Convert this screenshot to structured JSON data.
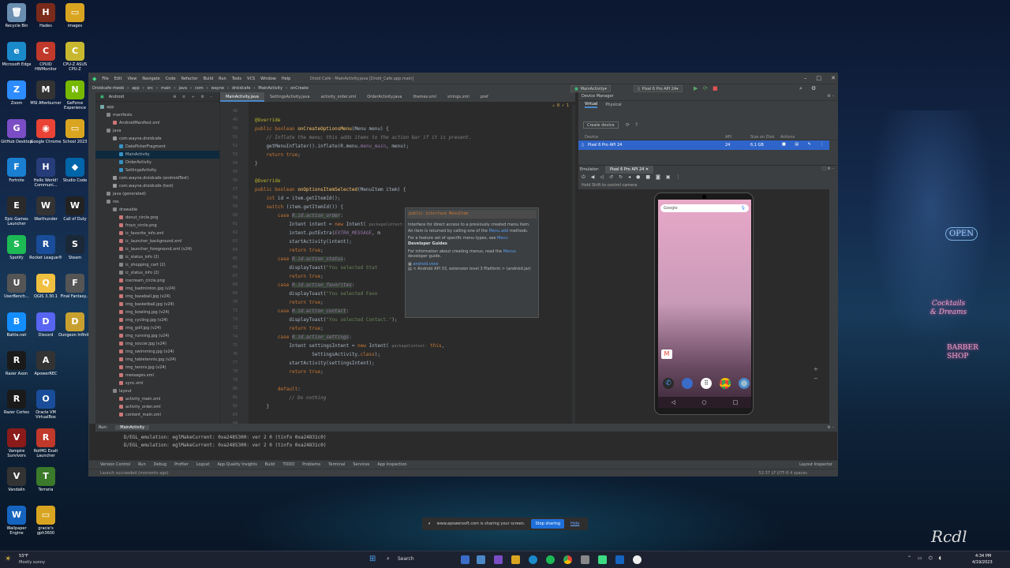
{
  "desktop": {
    "icons": [
      {
        "label": "Recycle Bin",
        "color": "#6b8fb0",
        "glyph": "🗑"
      },
      {
        "label": "Microsoft Edge",
        "color": "#1b8acb",
        "glyph": "e"
      },
      {
        "label": "Zoom",
        "color": "#2d8cff",
        "glyph": "Z"
      },
      {
        "label": "GitHub Desktop",
        "color": "#7a4dc4",
        "glyph": "G"
      },
      {
        "label": "Fortnite",
        "color": "#1a7fd0",
        "glyph": "F"
      },
      {
        "label": "Epic Games Launcher",
        "color": "#2a2a2a",
        "glyph": "E"
      },
      {
        "label": "Spotify",
        "color": "#1db954",
        "glyph": "S"
      },
      {
        "label": "UserBench...",
        "color": "#555",
        "glyph": "U"
      },
      {
        "label": "Battle.net",
        "color": "#148eff",
        "glyph": "B"
      },
      {
        "label": "Razer Axon",
        "color": "#1a1a1a",
        "glyph": "R"
      },
      {
        "label": "Razer Cortex",
        "color": "#1a1a1a",
        "glyph": "R"
      },
      {
        "label": "Vampire Survivors",
        "color": "#8b1a1a",
        "glyph": "V"
      },
      {
        "label": "Vandalin",
        "color": "#333",
        "glyph": "V"
      },
      {
        "label": "Wallpaper Engine",
        "color": "#1565c0",
        "glyph": "W"
      },
      {
        "label": "Hades",
        "color": "#7a2a1a",
        "glyph": "H"
      },
      {
        "label": "CPUID HWMonitor",
        "color": "#c0392b",
        "glyph": "C"
      },
      {
        "label": "MSI Afterburner",
        "color": "#333",
        "glyph": "M"
      },
      {
        "label": "Google Chrome",
        "color": "#ea4335",
        "glyph": "◉"
      },
      {
        "label": "Hello World! Communi...",
        "color": "#263d7a",
        "glyph": "H"
      },
      {
        "label": "Warthunder",
        "color": "#333",
        "glyph": "W"
      },
      {
        "label": "Rocket League®",
        "color": "#1a4d99",
        "glyph": "R"
      },
      {
        "label": "QGIS 3.30.1",
        "color": "#f0c040",
        "glyph": "Q"
      },
      {
        "label": "Discord",
        "color": "#5865f2",
        "glyph": "D"
      },
      {
        "label": "ApowerREC",
        "color": "#333",
        "glyph": "A"
      },
      {
        "label": "Oracle VM VirtualBox",
        "color": "#1a4d99",
        "glyph": "O"
      },
      {
        "label": "RotMG Exalt Launcher",
        "color": "#c0392b",
        "glyph": "R"
      },
      {
        "label": "Terraria",
        "color": "#3a7a2a",
        "glyph": "T"
      },
      {
        "label": "gracie's gph3600",
        "color": "#d9a521",
        "glyph": "▭"
      },
      {
        "label": "images",
        "color": "#d9a521",
        "glyph": "▭"
      },
      {
        "label": "CPU-Z ASUS CPU-Z",
        "color": "#c8b830",
        "glyph": "C"
      },
      {
        "label": "GeForce Experience",
        "color": "#76b900",
        "glyph": "N"
      },
      {
        "label": "School 2023",
        "color": "#d9a521",
        "glyph": "▭"
      },
      {
        "label": "Studio Code",
        "color": "#0065a9",
        "glyph": "◆"
      },
      {
        "label": "Call of Duty",
        "color": "#222",
        "glyph": "W"
      },
      {
        "label": "Steam",
        "color": "#1b2838",
        "glyph": "S"
      },
      {
        "label": "Final Fantasy...",
        "color": "#555",
        "glyph": "F"
      },
      {
        "label": "Dungeon Infinite",
        "color": "#c8a030",
        "glyph": "D"
      }
    ],
    "neon": {
      "open": "OPEN",
      "cocktails": "Cocktails & Dreams",
      "barber": "BARBER SHOP",
      "signature": "Rcdl"
    }
  },
  "ide": {
    "menu": [
      "File",
      "Edit",
      "View",
      "Navigate",
      "Code",
      "Refactor",
      "Build",
      "Run",
      "Tools",
      "VCS",
      "Window",
      "Help"
    ],
    "window_title": "Droid Cafe - MainActivity.java [Droid_Cafe.app.main]",
    "breadcrumbs": [
      "Droidcafe-rtweb",
      "app",
      "src",
      "main",
      "java",
      "com",
      "wayne",
      "droidcafe",
      "MainActivity",
      "onCreate"
    ],
    "run_config": "MainActivity",
    "device_config": "Pixel 6 Pro API 24",
    "project_view": "Android",
    "tree": [
      {
        "label": "app",
        "indent": 0,
        "color": "#7aa"
      },
      {
        "label": "manifests",
        "indent": 1,
        "color": "#888"
      },
      {
        "label": "AndroidManifest.xml",
        "indent": 2,
        "color": "#c77"
      },
      {
        "label": "java",
        "indent": 1,
        "color": "#888"
      },
      {
        "label": "com.wayne.droidcafe",
        "indent": 2,
        "color": "#999"
      },
      {
        "label": "DatePickerFragment",
        "indent": 3,
        "color": "#3592c4"
      },
      {
        "label": "MainActivity",
        "indent": 3,
        "color": "#3592c4",
        "selected": true
      },
      {
        "label": "OrderActivity",
        "indent": 3,
        "color": "#3592c4"
      },
      {
        "label": "SettingsActivity",
        "indent": 3,
        "color": "#3592c4"
      },
      {
        "label": "com.wayne.droidcafe (androidTest)",
        "indent": 2,
        "color": "#999"
      },
      {
        "label": "com.wayne.droidcafe (test)",
        "indent": 2,
        "color": "#999"
      },
      {
        "label": "java (generated)",
        "indent": 1,
        "color": "#888"
      },
      {
        "label": "res",
        "indent": 1,
        "color": "#888"
      },
      {
        "label": "drawable",
        "indent": 2,
        "color": "#888"
      },
      {
        "label": "donut_circle.png",
        "indent": 3,
        "color": "#c77"
      },
      {
        "label": "froyo_circle.png",
        "indent": 3,
        "color": "#c77"
      },
      {
        "label": "ic_favorite_info.xml",
        "indent": 3,
        "color": "#c77"
      },
      {
        "label": "ic_launcher_background.xml",
        "indent": 3,
        "color": "#c77"
      },
      {
        "label": "ic_launcher_foreground.xml (v24)",
        "indent": 3,
        "color": "#c77"
      },
      {
        "label": "ic_status_info (2)",
        "indent": 3,
        "color": "#888"
      },
      {
        "label": "ic_shopping_cart (2)",
        "indent": 3,
        "color": "#888"
      },
      {
        "label": "ic_status_info (2)",
        "indent": 3,
        "color": "#888"
      },
      {
        "label": "icecream_circle.png",
        "indent": 3,
        "color": "#c77"
      },
      {
        "label": "img_badminton.jpg (v24)",
        "indent": 3,
        "color": "#c77"
      },
      {
        "label": "img_baseball.jpg (v24)",
        "indent": 3,
        "color": "#c77"
      },
      {
        "label": "img_basketball.jpg (v24)",
        "indent": 3,
        "color": "#c77"
      },
      {
        "label": "img_bowling.jpg (v24)",
        "indent": 3,
        "color": "#c77"
      },
      {
        "label": "img_cycling.jpg (v24)",
        "indent": 3,
        "color": "#c77"
      },
      {
        "label": "img_golf.jpg (v24)",
        "indent": 3,
        "color": "#c77"
      },
      {
        "label": "img_running.jpg (v24)",
        "indent": 3,
        "color": "#c77"
      },
      {
        "label": "img_soccer.jpg (v24)",
        "indent": 3,
        "color": "#c77"
      },
      {
        "label": "img_swimming.jpg (v24)",
        "indent": 3,
        "color": "#c77"
      },
      {
        "label": "img_tabletennis.jpg (v24)",
        "indent": 3,
        "color": "#c77"
      },
      {
        "label": "img_tennis.jpg (v24)",
        "indent": 3,
        "color": "#c77"
      },
      {
        "label": "messages.xml",
        "indent": 3,
        "color": "#c77"
      },
      {
        "label": "sync.xml",
        "indent": 3,
        "color": "#c77"
      },
      {
        "label": "layout",
        "indent": 2,
        "color": "#888"
      },
      {
        "label": "activity_main.xml",
        "indent": 3,
        "color": "#c77"
      },
      {
        "label": "activity_order.xml",
        "indent": 3,
        "color": "#c77"
      },
      {
        "label": "content_main.xml",
        "indent": 3,
        "color": "#c77"
      }
    ],
    "tabs": [
      "MainActivity.java",
      "SettingsActivity.java",
      "activity_order.xml",
      "OrderActivity.java",
      "themes.xml",
      "strings.xml",
      "pref"
    ],
    "line_numbers": [
      "48",
      "49",
      "50",
      "51",
      "52",
      "53",
      "54",
      "55",
      "56",
      "57",
      "58",
      "59",
      "60",
      "61",
      "62",
      "63",
      "64",
      "65",
      "66",
      "67",
      "68",
      "69",
      "70",
      "71",
      "72",
      "73",
      "74",
      "75",
      "76",
      "77",
      "78",
      "79",
      "80",
      "81",
      "82",
      "83",
      "84",
      "85",
      "86",
      "87"
    ],
    "problems_count": "⚠ 8  ✓ 1",
    "popup": {
      "signature": "public interface MenuItem",
      "desc1": "Interface for direct access to a previously created menu item.",
      "desc2": "An item is returned by calling one of the",
      "desc2_link": "Menu.add",
      "desc2_end": "methods.",
      "desc3": "For a feature set of specific menu types, see",
      "desc3_link": "Menu",
      "guides_title": "Developer Guides",
      "guides_text": "For information about creating menus, read the",
      "guides_link": "Menus",
      "guides_end": "developer guide.",
      "pkg": "android.view",
      "platform": "< Android API 33, extension level 3 Platform > (android.jar)"
    },
    "device_manager": {
      "title": "Device Manager",
      "tabs": [
        "Virtual",
        "Physical"
      ],
      "create": "Create device",
      "columns": [
        "Device",
        "API",
        "Size on Disk",
        "Actions"
      ],
      "device": {
        "name": "Pixel 6 Pro API 24",
        "api": "24",
        "size": "6.1 GB"
      }
    },
    "emulator": {
      "label": "Emulator:",
      "tab": "Pixel 6 Pro API 24",
      "hint": "Hold Shift to control camera",
      "search": "Google"
    },
    "run": {
      "tab": "Run:",
      "config": "MainActivity",
      "lines": [
        "D/EGL_emulation: eglMakeCurrent: 0xa2485300: ver 2 0 (tinfo 0xa24831c0)",
        "D/EGL_emulation: eglMakeCurrent: 0xa2485300: ver 2 0 (tinfo 0xa24831c0)"
      ]
    },
    "toolwindows": [
      "Version Control",
      "Run",
      "Debug",
      "Profiler",
      "Logcat",
      "App Quality Insights",
      "Build",
      "TODO",
      "Problems",
      "Terminal",
      "Services",
      "App Inspection"
    ],
    "layout_inspector": "Layout Inspector",
    "status": "Launch succeeded (moments ago)",
    "status_right": "52:37  LF  UTF-8  4 spaces"
  },
  "share": {
    "text": "www.apowersoft.com is sharing your screen.",
    "stop": "Stop sharing",
    "hide": "Hide"
  },
  "taskbar": {
    "weather_temp": "53°F",
    "weather_desc": "Mostly sunny",
    "search": "Search",
    "time": "4:34 PM",
    "date": "4/19/2023"
  }
}
